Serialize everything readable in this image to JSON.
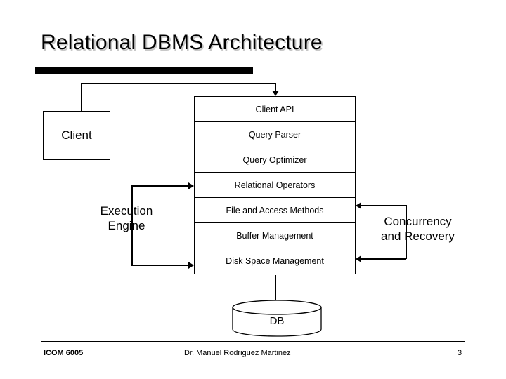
{
  "slide": {
    "title": "Relational DBMS Architecture"
  },
  "diagram": {
    "client_box": {
      "label": "Client"
    },
    "stack": {
      "rows": [
        {
          "label": "Client API"
        },
        {
          "label": "Query Parser"
        },
        {
          "label": "Query Optimizer"
        },
        {
          "label": "Relational Operators"
        },
        {
          "label": "File and Access Methods"
        },
        {
          "label": "Buffer Management"
        },
        {
          "label": "Disk Space Management"
        }
      ]
    },
    "execution_engine": {
      "line1": "Execution",
      "line2": "Engine"
    },
    "concurrency": {
      "line1": "Concurrency",
      "line2": "and Recovery"
    },
    "database": {
      "label": "DB"
    }
  },
  "footer": {
    "course": "ICOM 6005",
    "author": "Dr. Manuel Rodriguez Martinez",
    "page": "3"
  },
  "colors": {
    "ink": "#000000",
    "background": "#ffffff",
    "title_shadow": "#c8c8c8"
  }
}
